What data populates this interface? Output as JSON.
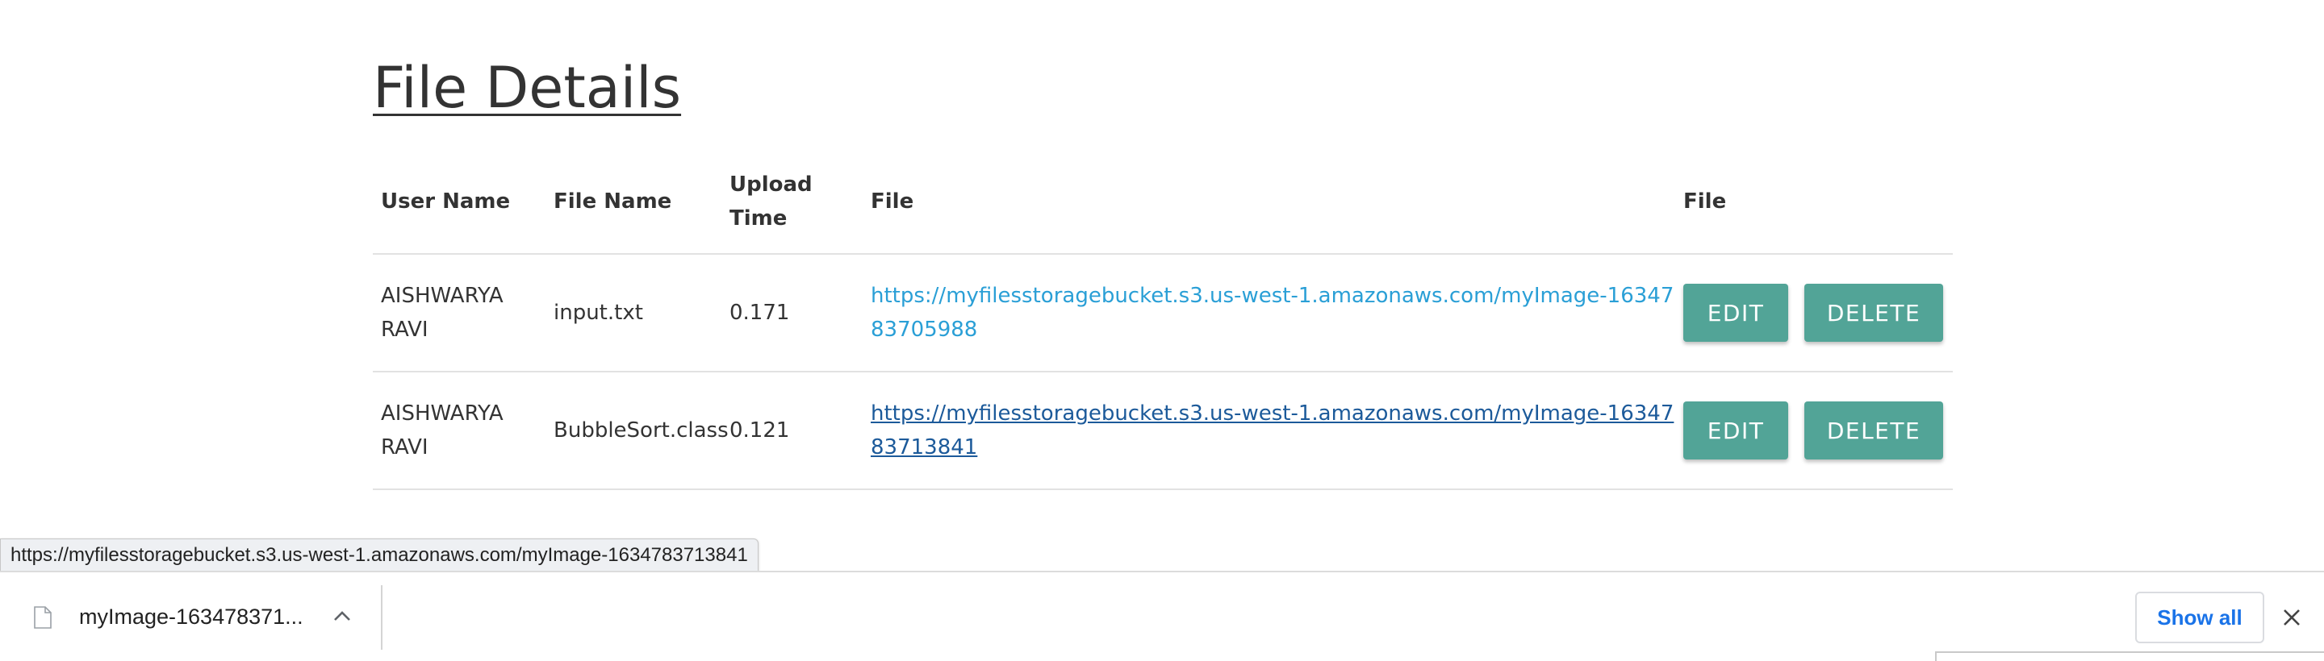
{
  "page": {
    "title": "File Details"
  },
  "table": {
    "headers": {
      "user_name": "User Name",
      "file_name": "File Name",
      "upload_time": "Upload Time",
      "file": "File",
      "actions": "File"
    },
    "rows": [
      {
        "user_name": "AISHWARYA RAVI",
        "file_name": "input.txt",
        "upload_time": "0.171",
        "file_url": "https://myfilesstoragebucket.s3.us-west-1.amazonaws.com/myImage-1634783705988",
        "edit_label": "EDIT",
        "delete_label": "DELETE"
      },
      {
        "user_name": "AISHWARYA RAVI",
        "file_name": "BubbleSort.class",
        "upload_time": "0.121",
        "file_url": "https://myfilesstoragebucket.s3.us-west-1.amazonaws.com/myImage-1634783713841",
        "edit_label": "EDIT",
        "delete_label": "DELETE"
      }
    ]
  },
  "status_bar": {
    "url": "https://myfilesstoragebucket.s3.us-west-1.amazonaws.com/myImage-1634783713841"
  },
  "download_bar": {
    "item_name": "myImage-163478371...",
    "item_icon": "file-icon",
    "menu_icon": "chevron-up-icon",
    "show_all_label": "Show all",
    "close_icon": "close-icon"
  },
  "colors": {
    "button": "#52a497",
    "link": "#2a9fd6",
    "link_hover": "#1c5a9a",
    "show_all": "#1a73e8"
  }
}
